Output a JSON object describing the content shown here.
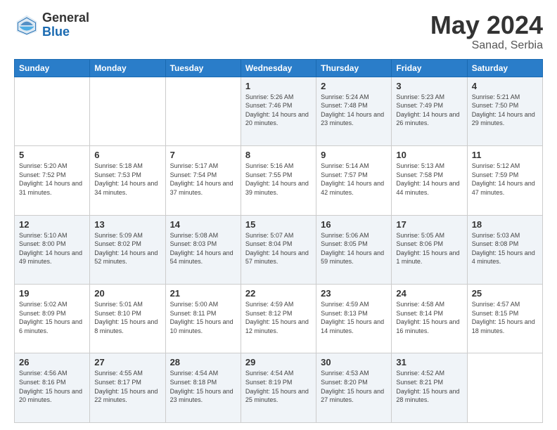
{
  "header": {
    "logo_general": "General",
    "logo_blue": "Blue",
    "month": "May 2024",
    "location": "Sanad, Serbia"
  },
  "weekdays": [
    "Sunday",
    "Monday",
    "Tuesday",
    "Wednesday",
    "Thursday",
    "Friday",
    "Saturday"
  ],
  "weeks": [
    [
      {
        "day": "",
        "sunrise": "",
        "sunset": "",
        "daylight": ""
      },
      {
        "day": "",
        "sunrise": "",
        "sunset": "",
        "daylight": ""
      },
      {
        "day": "",
        "sunrise": "",
        "sunset": "",
        "daylight": ""
      },
      {
        "day": "1",
        "sunrise": "Sunrise: 5:26 AM",
        "sunset": "Sunset: 7:46 PM",
        "daylight": "Daylight: 14 hours and 20 minutes."
      },
      {
        "day": "2",
        "sunrise": "Sunrise: 5:24 AM",
        "sunset": "Sunset: 7:48 PM",
        "daylight": "Daylight: 14 hours and 23 minutes."
      },
      {
        "day": "3",
        "sunrise": "Sunrise: 5:23 AM",
        "sunset": "Sunset: 7:49 PM",
        "daylight": "Daylight: 14 hours and 26 minutes."
      },
      {
        "day": "4",
        "sunrise": "Sunrise: 5:21 AM",
        "sunset": "Sunset: 7:50 PM",
        "daylight": "Daylight: 14 hours and 29 minutes."
      }
    ],
    [
      {
        "day": "5",
        "sunrise": "Sunrise: 5:20 AM",
        "sunset": "Sunset: 7:52 PM",
        "daylight": "Daylight: 14 hours and 31 minutes."
      },
      {
        "day": "6",
        "sunrise": "Sunrise: 5:18 AM",
        "sunset": "Sunset: 7:53 PM",
        "daylight": "Daylight: 14 hours and 34 minutes."
      },
      {
        "day": "7",
        "sunrise": "Sunrise: 5:17 AM",
        "sunset": "Sunset: 7:54 PM",
        "daylight": "Daylight: 14 hours and 37 minutes."
      },
      {
        "day": "8",
        "sunrise": "Sunrise: 5:16 AM",
        "sunset": "Sunset: 7:55 PM",
        "daylight": "Daylight: 14 hours and 39 minutes."
      },
      {
        "day": "9",
        "sunrise": "Sunrise: 5:14 AM",
        "sunset": "Sunset: 7:57 PM",
        "daylight": "Daylight: 14 hours and 42 minutes."
      },
      {
        "day": "10",
        "sunrise": "Sunrise: 5:13 AM",
        "sunset": "Sunset: 7:58 PM",
        "daylight": "Daylight: 14 hours and 44 minutes."
      },
      {
        "day": "11",
        "sunrise": "Sunrise: 5:12 AM",
        "sunset": "Sunset: 7:59 PM",
        "daylight": "Daylight: 14 hours and 47 minutes."
      }
    ],
    [
      {
        "day": "12",
        "sunrise": "Sunrise: 5:10 AM",
        "sunset": "Sunset: 8:00 PM",
        "daylight": "Daylight: 14 hours and 49 minutes."
      },
      {
        "day": "13",
        "sunrise": "Sunrise: 5:09 AM",
        "sunset": "Sunset: 8:02 PM",
        "daylight": "Daylight: 14 hours and 52 minutes."
      },
      {
        "day": "14",
        "sunrise": "Sunrise: 5:08 AM",
        "sunset": "Sunset: 8:03 PM",
        "daylight": "Daylight: 14 hours and 54 minutes."
      },
      {
        "day": "15",
        "sunrise": "Sunrise: 5:07 AM",
        "sunset": "Sunset: 8:04 PM",
        "daylight": "Daylight: 14 hours and 57 minutes."
      },
      {
        "day": "16",
        "sunrise": "Sunrise: 5:06 AM",
        "sunset": "Sunset: 8:05 PM",
        "daylight": "Daylight: 14 hours and 59 minutes."
      },
      {
        "day": "17",
        "sunrise": "Sunrise: 5:05 AM",
        "sunset": "Sunset: 8:06 PM",
        "daylight": "Daylight: 15 hours and 1 minute."
      },
      {
        "day": "18",
        "sunrise": "Sunrise: 5:03 AM",
        "sunset": "Sunset: 8:08 PM",
        "daylight": "Daylight: 15 hours and 4 minutes."
      }
    ],
    [
      {
        "day": "19",
        "sunrise": "Sunrise: 5:02 AM",
        "sunset": "Sunset: 8:09 PM",
        "daylight": "Daylight: 15 hours and 6 minutes."
      },
      {
        "day": "20",
        "sunrise": "Sunrise: 5:01 AM",
        "sunset": "Sunset: 8:10 PM",
        "daylight": "Daylight: 15 hours and 8 minutes."
      },
      {
        "day": "21",
        "sunrise": "Sunrise: 5:00 AM",
        "sunset": "Sunset: 8:11 PM",
        "daylight": "Daylight: 15 hours and 10 minutes."
      },
      {
        "day": "22",
        "sunrise": "Sunrise: 4:59 AM",
        "sunset": "Sunset: 8:12 PM",
        "daylight": "Daylight: 15 hours and 12 minutes."
      },
      {
        "day": "23",
        "sunrise": "Sunrise: 4:59 AM",
        "sunset": "Sunset: 8:13 PM",
        "daylight": "Daylight: 15 hours and 14 minutes."
      },
      {
        "day": "24",
        "sunrise": "Sunrise: 4:58 AM",
        "sunset": "Sunset: 8:14 PM",
        "daylight": "Daylight: 15 hours and 16 minutes."
      },
      {
        "day": "25",
        "sunrise": "Sunrise: 4:57 AM",
        "sunset": "Sunset: 8:15 PM",
        "daylight": "Daylight: 15 hours and 18 minutes."
      }
    ],
    [
      {
        "day": "26",
        "sunrise": "Sunrise: 4:56 AM",
        "sunset": "Sunset: 8:16 PM",
        "daylight": "Daylight: 15 hours and 20 minutes."
      },
      {
        "day": "27",
        "sunrise": "Sunrise: 4:55 AM",
        "sunset": "Sunset: 8:17 PM",
        "daylight": "Daylight: 15 hours and 22 minutes."
      },
      {
        "day": "28",
        "sunrise": "Sunrise: 4:54 AM",
        "sunset": "Sunset: 8:18 PM",
        "daylight": "Daylight: 15 hours and 23 minutes."
      },
      {
        "day": "29",
        "sunrise": "Sunrise: 4:54 AM",
        "sunset": "Sunset: 8:19 PM",
        "daylight": "Daylight: 15 hours and 25 minutes."
      },
      {
        "day": "30",
        "sunrise": "Sunrise: 4:53 AM",
        "sunset": "Sunset: 8:20 PM",
        "daylight": "Daylight: 15 hours and 27 minutes."
      },
      {
        "day": "31",
        "sunrise": "Sunrise: 4:52 AM",
        "sunset": "Sunset: 8:21 PM",
        "daylight": "Daylight: 15 hours and 28 minutes."
      },
      {
        "day": "",
        "sunrise": "",
        "sunset": "",
        "daylight": ""
      }
    ]
  ]
}
